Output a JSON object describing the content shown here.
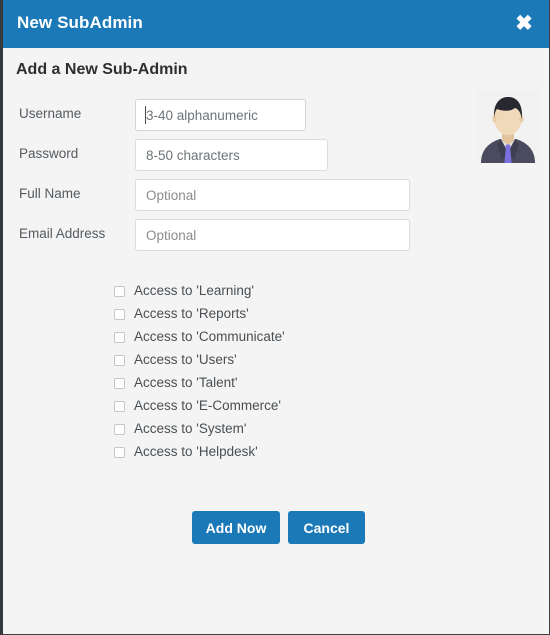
{
  "window": {
    "title": "New SubAdmin",
    "close_icon": "close-icon",
    "header_color": "#1b79b8",
    "body_color": "#f4f4f4"
  },
  "form": {
    "heading": "Add a New Sub-Admin",
    "avatar_alt": "user-avatar",
    "fields": [
      {
        "label": "Username",
        "placeholder": "3-40 alphanumeric",
        "value": "",
        "focused": true
      },
      {
        "label": "Password",
        "placeholder": "8-50 characters",
        "value": "",
        "focused": false
      },
      {
        "label": "Full Name",
        "placeholder": "Optional",
        "value": "",
        "focused": false
      },
      {
        "label": "Email Address",
        "placeholder": "Optional",
        "value": "",
        "focused": false
      }
    ],
    "permissions": [
      {
        "label": "Access to 'Learning'",
        "checked": false
      },
      {
        "label": "Access to 'Reports'",
        "checked": false
      },
      {
        "label": "Access to 'Communicate'",
        "checked": false
      },
      {
        "label": "Access to 'Users'",
        "checked": false
      },
      {
        "label": "Access to 'Talent'",
        "checked": false
      },
      {
        "label": "Access to 'E-Commerce'",
        "checked": false
      },
      {
        "label": "Access to 'System'",
        "checked": false
      },
      {
        "label": "Access to 'Helpdesk'",
        "checked": false
      }
    ],
    "buttons": {
      "submit": "Add Now",
      "cancel": "Cancel"
    }
  }
}
